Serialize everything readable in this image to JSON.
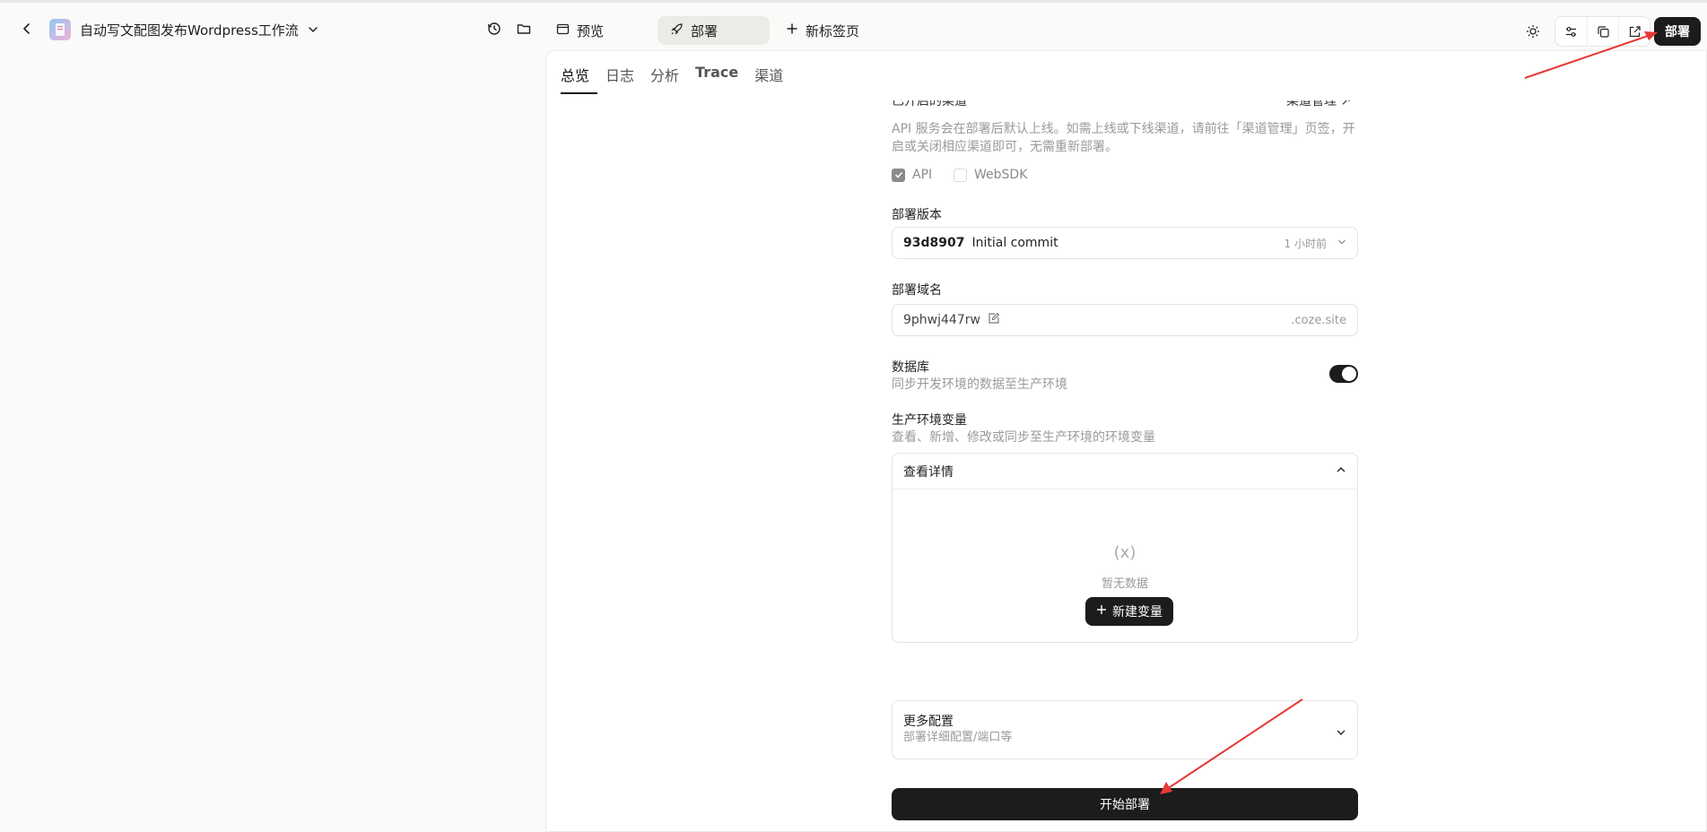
{
  "header": {
    "app_title": "自动写文配图发布Wordpress工作流",
    "tabs": [
      {
        "label": "预览"
      },
      {
        "label": "部署"
      },
      {
        "label": "新标签页"
      }
    ],
    "deploy_label": "部署"
  },
  "subtabs": [
    "总览",
    "日志",
    "分析",
    "Trace",
    "渠道"
  ],
  "channels": {
    "title": "已开启的渠道",
    "manage_link": "渠道管理",
    "description_line1": "API 服务会在部署后默认上线。如需上线或下线渠道，请前往「渠道管理」页签，开",
    "description_line2": "启或关闭相应渠道即可，无需重新部署。",
    "options": [
      {
        "label": "API",
        "checked": true
      },
      {
        "label": "WebSDK",
        "checked": false
      }
    ]
  },
  "version": {
    "label": "部署版本",
    "hash": "93d8907",
    "message": "Initial commit",
    "time": "1 小时前"
  },
  "domain": {
    "label": "部署域名",
    "value": "9phwj447rw",
    "suffix": ".coze.site"
  },
  "database": {
    "label": "数据库",
    "description": "同步开发环境的数据至生产环境",
    "enabled": true
  },
  "env": {
    "label": "生产环境变量",
    "description": "查看、新增、修改或同步至生产环境的环境变量",
    "details_label": "查看详情",
    "empty_icon": "(x)",
    "empty_text": "暂无数据",
    "add_button": "新建变量"
  },
  "more": {
    "label": "更多配置",
    "description": "部署详细配置/端口等"
  },
  "start_button": "开始部署",
  "colors": {
    "primary": "#1c1c1c",
    "annotation_arrow": "#e53935"
  }
}
